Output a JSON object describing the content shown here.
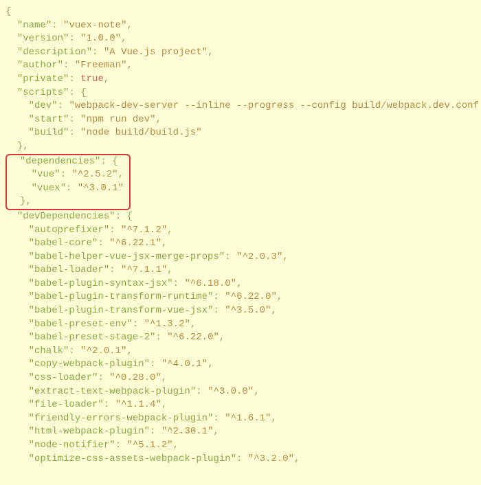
{
  "name": "vuex-note",
  "version": "1.0.0",
  "description": "A Vue.js project",
  "author": "Freeman",
  "private_val": "true",
  "scripts": {
    "dev": "webpack-dev-server --inline --progress --config build/webpack.dev.conf.js",
    "start": "npm run dev",
    "build": "node build/build.js"
  },
  "dependencies": {
    "vue": "^2.5.2",
    "vuex": "^3.0.1"
  },
  "devDependencies": {
    "autoprefixer": "^7.1.2",
    "babel-core": "^6.22.1",
    "babel-helper-vue-jsx-merge-props": "^2.0.3",
    "babel-loader": "^7.1.1",
    "babel-plugin-syntax-jsx": "^6.18.0",
    "babel-plugin-transform-runtime": "^6.22.0",
    "babel-plugin-transform-vue-jsx": "^3.5.0",
    "babel-preset-env": "^1.3.2",
    "babel-preset-stage-2": "^6.22.0",
    "chalk": "^2.0.1",
    "copy-webpack-plugin": "^4.0.1",
    "css-loader": "^0.28.0",
    "extract-text-webpack-plugin": "^3.0.0",
    "file-loader": "^1.1.4",
    "friendly-errors-webpack-plugin": "^1.6.1",
    "html-webpack-plugin": "^2.30.1",
    "node-notifier": "^5.1.2",
    "optimize-css-assets-webpack-plugin": "^3.2.0"
  },
  "labels": {
    "name": "name",
    "version": "version",
    "description": "description",
    "author": "author",
    "private": "private",
    "scripts": "scripts",
    "dev": "dev",
    "start": "start",
    "build": "build",
    "dependencies": "dependencies",
    "vue": "vue",
    "vuex": "vuex",
    "devDependencies": "devDependencies"
  }
}
